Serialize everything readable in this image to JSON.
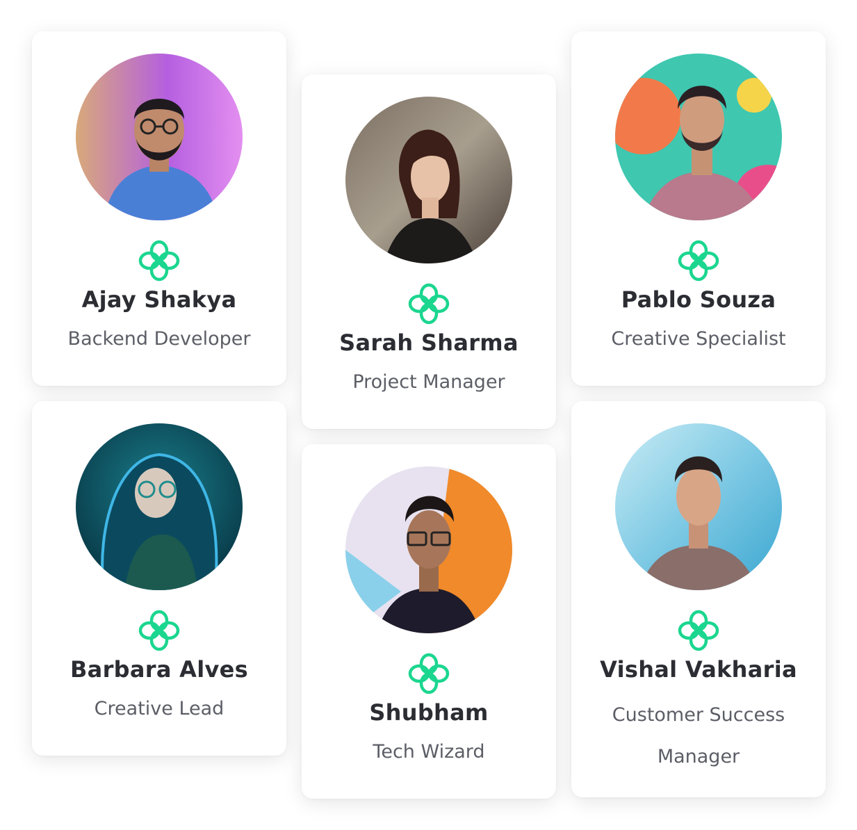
{
  "accent_color": "#1bd68f",
  "badge_icon": "clover-badge-icon",
  "members": [
    {
      "name": "Ajay Shakya",
      "role": "Backend Developer",
      "avatar_colors": [
        "#d8a97a",
        "#b55fe0",
        "#e38ff0"
      ]
    },
    {
      "name": "Sarah Sharma",
      "role": "Project Manager",
      "avatar_colors": [
        "#7b6f62",
        "#a89e8e",
        "#4a3e38"
      ]
    },
    {
      "name": "Pablo Souza",
      "role": "Creative Specialist",
      "avatar_colors": [
        "#3fc7b0",
        "#f27a4a",
        "#e84f8a"
      ]
    },
    {
      "name": "Barbara Alves",
      "role": "Creative Lead",
      "avatar_colors": [
        "#0b4a5e",
        "#1a7e8c",
        "#062f3d"
      ]
    },
    {
      "name": "Shubham",
      "role": "Tech Wizard",
      "avatar_colors": [
        "#e8e2f0",
        "#f08a2a",
        "#8ad0ea"
      ]
    },
    {
      "name": "Vishal Vakharia",
      "role": "Customer Success Manager",
      "avatar_colors": [
        "#7ec9e4",
        "#3aa6d0",
        "#c9ecf5"
      ]
    }
  ]
}
